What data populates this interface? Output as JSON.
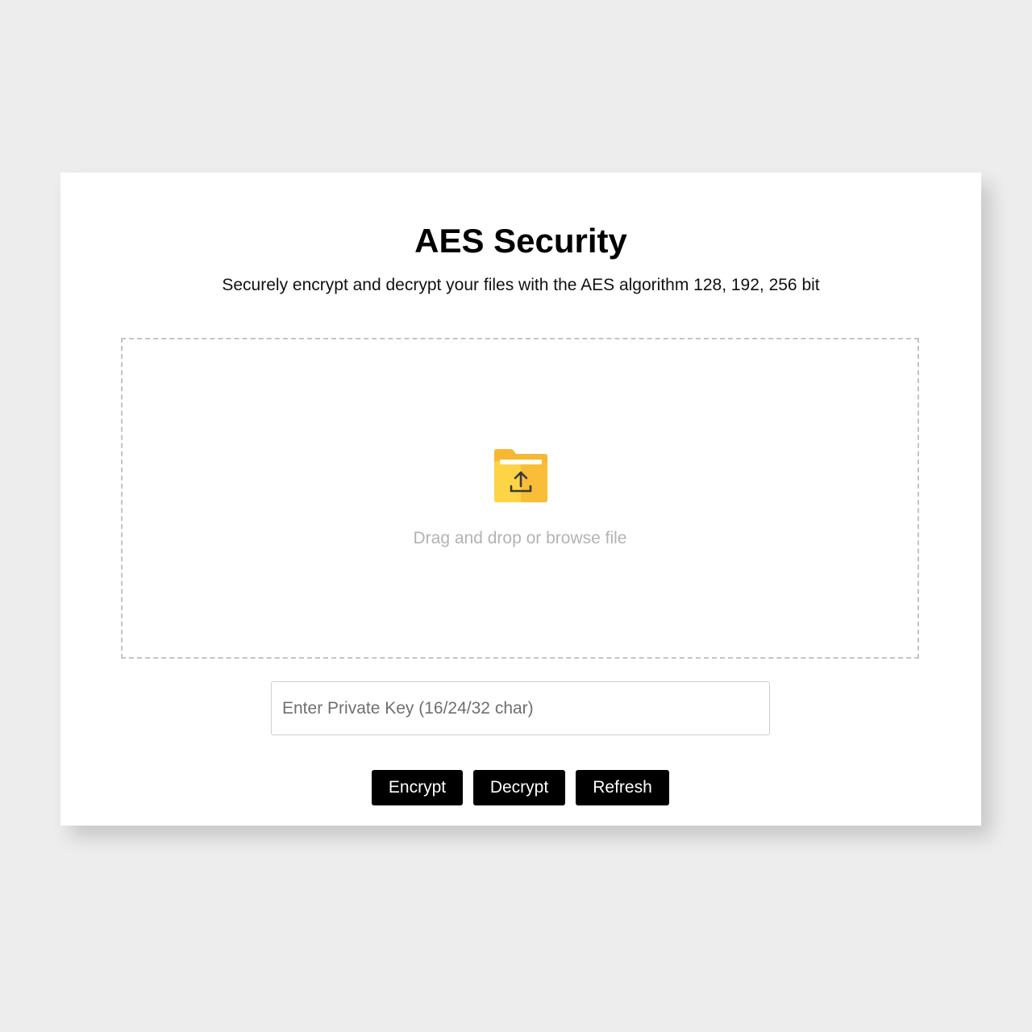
{
  "app": {
    "title": "AES Security",
    "subtitle": "Securely encrypt and decrypt your files with the AES algorithm 128, 192, 256 bit"
  },
  "dropzone": {
    "icon": "folder-upload-icon",
    "text": "Drag and drop or browse file"
  },
  "key_input": {
    "value": "",
    "placeholder": "Enter Private Key (16/24/32 char)"
  },
  "actions": {
    "encrypt_label": "Encrypt",
    "decrypt_label": "Decrypt",
    "refresh_label": "Refresh"
  },
  "colors": {
    "background": "#ededed",
    "card": "#ffffff",
    "button": "#000000",
    "button_text": "#ffffff",
    "folder_front": "#fdd446",
    "folder_back": "#f7b731",
    "dashed_border": "#c4c4c4"
  }
}
